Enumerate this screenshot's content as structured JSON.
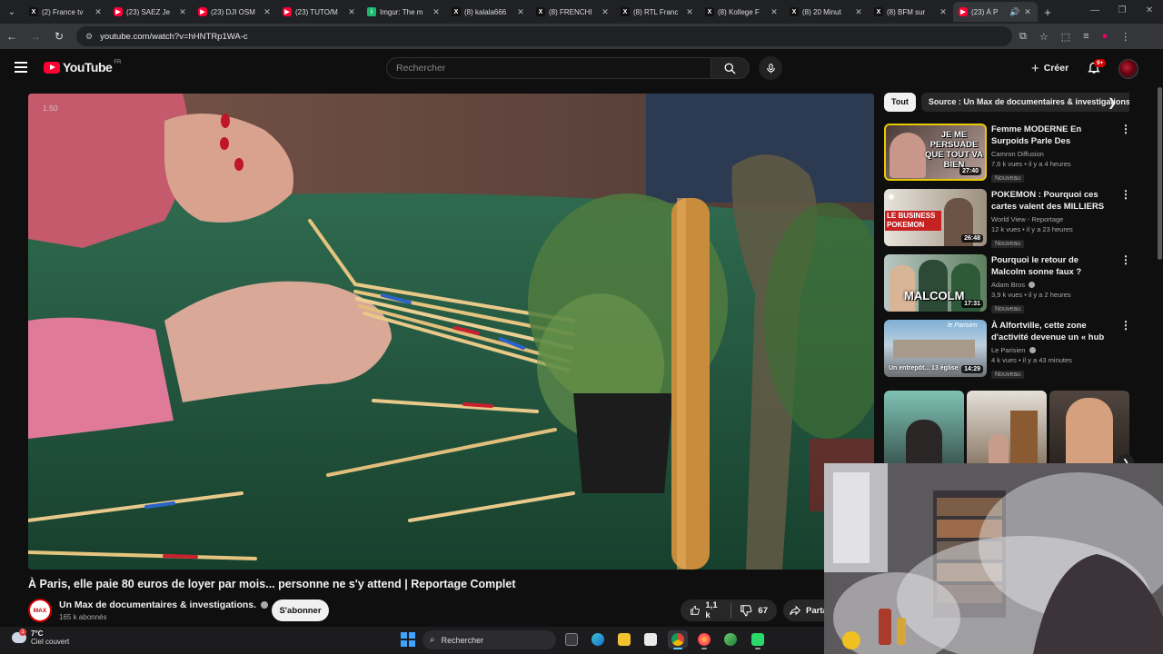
{
  "browser": {
    "tabs": [
      {
        "title": "(2) France tv",
        "icon": "x-icon"
      },
      {
        "title": "(23) SAEZ Je",
        "icon": "youtube-icon"
      },
      {
        "title": "(23) DJI OSM",
        "icon": "youtube-icon"
      },
      {
        "title": "(23) TUTO/M",
        "icon": "youtube-icon"
      },
      {
        "title": "Imgur: The m",
        "icon": "imgur-icon"
      },
      {
        "title": "(8) kalala666",
        "icon": "x-icon"
      },
      {
        "title": "(8) FRENCHI",
        "icon": "x-icon"
      },
      {
        "title": "(8) RTL Franc",
        "icon": "x-icon"
      },
      {
        "title": "(8) Kollege F",
        "icon": "x-icon"
      },
      {
        "title": "(8) 20 Minut",
        "icon": "x-icon"
      },
      {
        "title": "(8) BFM sur",
        "icon": "x-icon"
      },
      {
        "title": "(23) À P",
        "icon": "youtube-icon",
        "active": true
      }
    ],
    "url": "youtube.com/watch?v=hHNTRp1WA-c"
  },
  "youtube": {
    "logo_text": "YouTube",
    "country_code": "FR",
    "search_placeholder": "Rechercher",
    "create_label": "Créer",
    "notifications_badge": "9+"
  },
  "video": {
    "speed_overlay": "1.50",
    "title": "À Paris, elle paie 80 euros de loyer par mois... personne ne s'y attend | Reportage Complet",
    "channel_logo_text": "MAX",
    "channel_name": "Un Max de documentaires & investigations.",
    "subscribers": "165 k abonnés",
    "subscribe_label": "S'abonner",
    "likes": "1,1 k",
    "dislikes": "67",
    "share_label": "Partager"
  },
  "sidebar": {
    "chips": [
      "Tout",
      "Source : Un Max de documentaires & investigations."
    ],
    "recommendations": [
      {
        "title": "Femme MODERNE En Surpoids Parle Des Relations ...",
        "channel": "Camron Diffusion",
        "verified": false,
        "meta": "7,6 k vues • il y a 4 heures",
        "badge": "Nouveau",
        "duration": "27:40",
        "thumb_text": "JE ME PERSUADE QUE TOUT VA BIEN"
      },
      {
        "title": "POKEMON : Pourquoi ces cartes valent des MILLIERS ...",
        "channel": "World View - Reportage",
        "verified": false,
        "meta": "12 k vues • il y a 23 heures",
        "badge": "Nouveau",
        "duration": "26:48",
        "thumb_text": "LE BUSINESS POKEMON"
      },
      {
        "title": "Pourquoi le retour de Malcolm sonne faux ?",
        "channel": "Adam Bros",
        "verified": true,
        "meta": "3,9 k vues • il y a 2 heures",
        "badge": "Nouveau",
        "duration": "17:31",
        "thumb_text": "MALCOLM"
      },
      {
        "title": "À Alfortville, cette zone d'activité devenue un « hub à ...",
        "channel": "Le Parisien",
        "verified": true,
        "meta": "4 k vues • il y a 43 minutes",
        "badge": "Nouveau",
        "duration": "14:29",
        "thumb_text": "Un entrepôt... 13 église"
      }
    ]
  },
  "taskbar": {
    "temperature": "7°C",
    "condition": "Ciel couvert",
    "weather_badge": "1",
    "search_label": "Rechercher"
  },
  "colors": {
    "youtube_red": "#ff0033",
    "background": "#0f0f0f",
    "chip_selected": "#f1f1f1"
  }
}
